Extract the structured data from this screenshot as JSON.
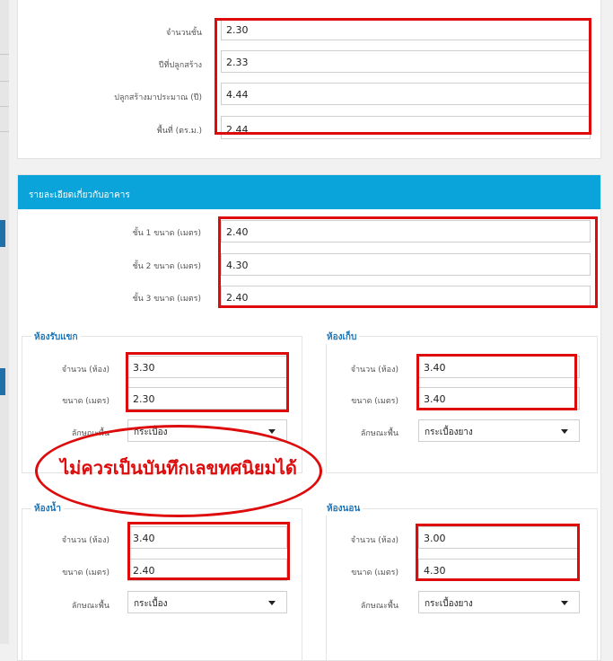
{
  "building": {
    "rows": [
      {
        "label": "จำนวนชั้น",
        "value": "2.30"
      },
      {
        "label": "ปีที่ปลูกสร้าง",
        "value": "2.33"
      },
      {
        "label": "ปลูกสร้างมาประมาณ (ปี)",
        "value": "4.44"
      },
      {
        "label": "พื้นที่ (ตร.ม.)",
        "value": "2.44"
      }
    ]
  },
  "details": {
    "title": "รายละเอียดเกี่ยวกับอาคาร",
    "floors": [
      {
        "label": "ชั้น 1 ขนาด (เมตร)",
        "value": "2.40"
      },
      {
        "label": "ชั้น 2 ขนาด (เมตร)",
        "value": "4.30"
      },
      {
        "label": "ชั้น 3 ขนาด (เมตร)",
        "value": "2.40"
      }
    ]
  },
  "rooms": {
    "reception": {
      "title": "ห้องรับแขก",
      "count_label": "จำนวน (ห้อง)",
      "count": "3.30",
      "size_label": "ขนาด (เมตร)",
      "size": "2.30",
      "floor_label": "ลักษณะพื้น",
      "floor": "กระเบื้อง"
    },
    "storage": {
      "title": "ห้องเก็บ",
      "count_label": "จำนวน (ห้อง)",
      "count": "3.40",
      "size_label": "ขนาด (เมตร)",
      "size": "3.40",
      "floor_label": "ลักษณะพื้น",
      "floor": "กระเบื้องยาง"
    },
    "bathroom": {
      "title": "ห้องน้ำ",
      "count_label": "จำนวน (ห้อง)",
      "count": "3.40",
      "size_label": "ขนาด (เมตร)",
      "size": "2.40",
      "floor_label": "ลักษณะพื้น",
      "floor": "กระเบื้อง"
    },
    "bedroom": {
      "title": "ห้องนอน",
      "count_label": "จำนวน (ห้อง)",
      "count": "3.00",
      "size_label": "ขนาด (เมตร)",
      "size": "4.30",
      "floor_label": "ลักษณะพื้น",
      "floor": "กระเบื้องยาง"
    }
  },
  "annotation": {
    "text": "ไม่ควรเป็นบันทึกเลขทศนิยมได้",
    "color": "#dd0b0b"
  },
  "colors": {
    "header": "#0aa3da",
    "group_title": "#1b75b9"
  }
}
